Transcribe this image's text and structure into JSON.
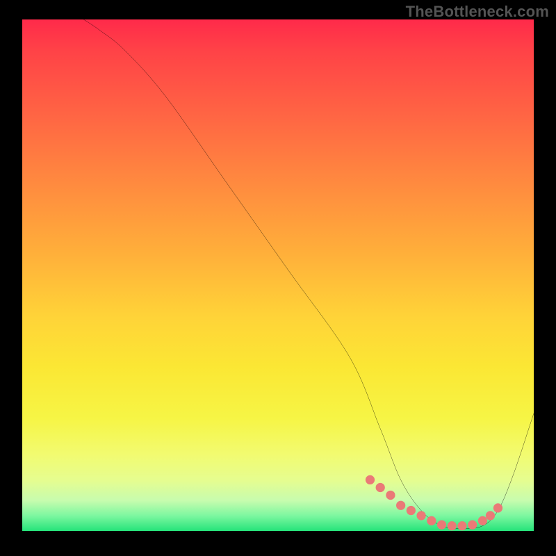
{
  "watermark": "TheBottleneck.com",
  "chart_data": {
    "type": "line",
    "title": "",
    "xlabel": "",
    "ylabel": "",
    "xlim": [
      0,
      100
    ],
    "ylim": [
      0,
      100
    ],
    "series": [
      {
        "name": "curve",
        "x": [
          12,
          15,
          20,
          28,
          40,
          52,
          64,
          70,
          74,
          78,
          82,
          86,
          90,
          93,
          96,
          100
        ],
        "y": [
          100,
          98,
          94,
          85,
          68,
          51,
          34,
          20,
          10,
          4,
          1,
          0.5,
          1,
          4,
          11,
          23
        ]
      }
    ],
    "markers": {
      "name": "highlight-dots",
      "x": [
        68,
        70,
        72,
        74,
        76,
        78,
        80,
        82,
        84,
        86,
        88,
        90,
        91.5,
        93
      ],
      "y": [
        10,
        8.5,
        7,
        5,
        4,
        3,
        2,
        1.2,
        1,
        1,
        1.2,
        2,
        3,
        4.5
      ]
    },
    "colors": {
      "curve": "#000000",
      "markers": "#ea7a77",
      "gradient_top": "#ff2a4a",
      "gradient_bottom": "#25e37a"
    }
  }
}
